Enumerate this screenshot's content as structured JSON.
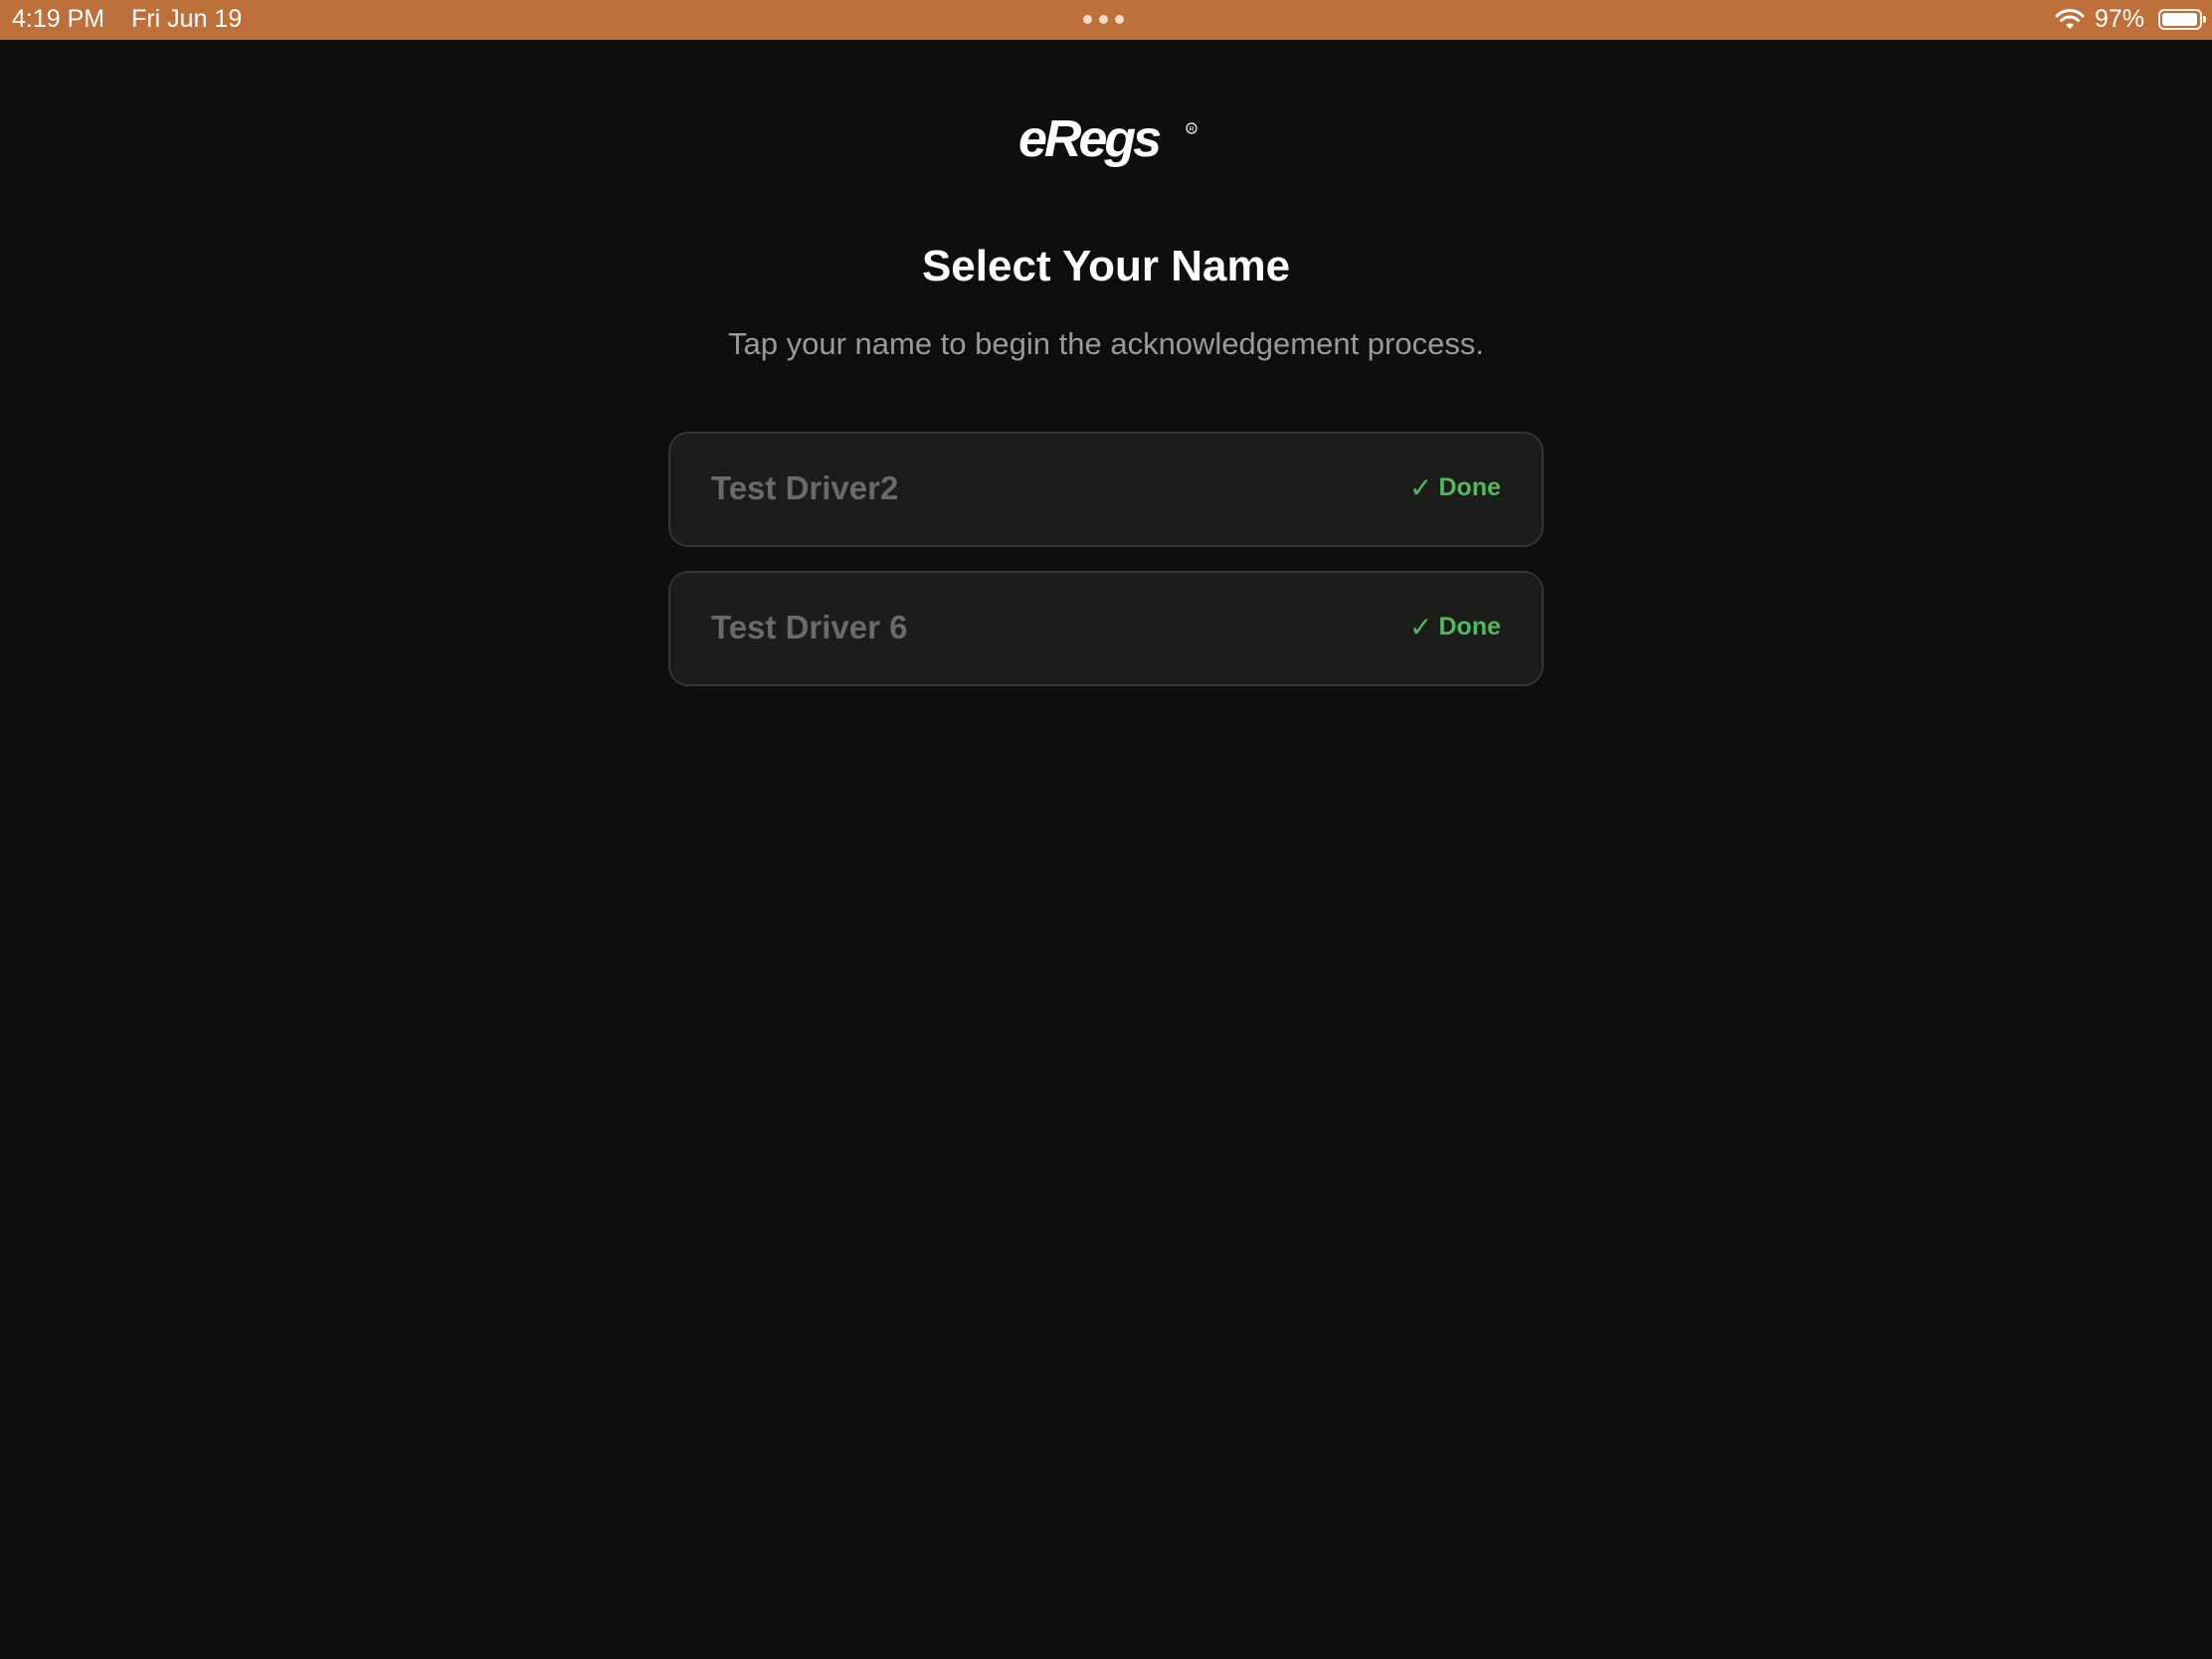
{
  "status_bar": {
    "time": "4:19 PM",
    "date": "Fri Jun 19",
    "battery_percent": "97%",
    "battery_level": 0.97
  },
  "logo": {
    "text": "eRegs"
  },
  "title": "Select Your Name",
  "subtitle": "Tap your name to begin the acknowledgement process.",
  "names": [
    {
      "name": "Test Driver2",
      "status": "Done"
    },
    {
      "name": "Test Driver 6",
      "status": "Done"
    }
  ],
  "colors": {
    "status_bar": "#bd703a",
    "background": "#0e0e0d",
    "card": "#1c1c1b",
    "done": "#4fba5e"
  }
}
